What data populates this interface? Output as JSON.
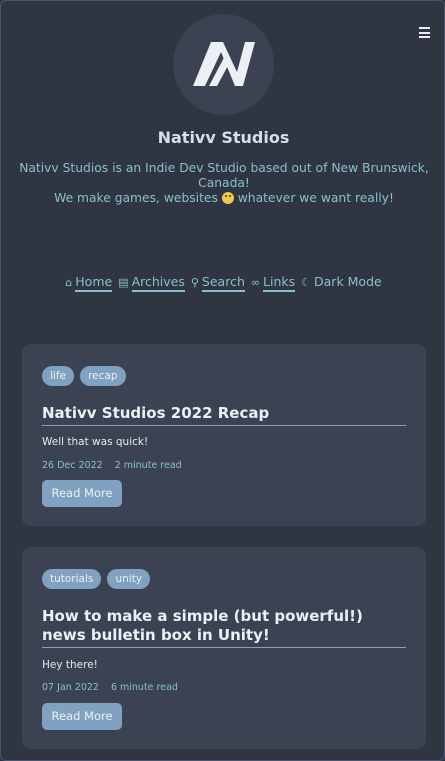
{
  "site": {
    "title": "Nativv Studios",
    "desc_line1": "Nativv Studios is an Indie Dev Studio based out of New Brunswick, Canada!",
    "desc_line2_a": "We make games, websites",
    "desc_line2_b": "whatever we want really!"
  },
  "nav": [
    {
      "label": "Home",
      "icon": "home-icon"
    },
    {
      "label": "Archives",
      "icon": "archive-icon"
    },
    {
      "label": "Search",
      "icon": "search-icon"
    },
    {
      "label": "Links",
      "icon": "link-icon"
    },
    {
      "label": "Dark Mode",
      "icon": "moon-icon"
    }
  ],
  "posts": [
    {
      "tags": [
        "life",
        "recap"
      ],
      "title": "Nativv Studios 2022 Recap",
      "excerpt": "Well that was quick!",
      "date": "26 Dec 2022",
      "read_time": "2 minute read",
      "button": "Read More"
    },
    {
      "tags": [
        "tutorials",
        "unity"
      ],
      "title": "How to make a simple (but powerful!) news bulletin box in Unity!",
      "excerpt": "Hey there!",
      "date": "07 Jan 2022",
      "read_time": "6 minute read",
      "button": "Read More"
    }
  ],
  "colors": {
    "background": "#2e3440",
    "card": "#3b4252",
    "accent": "#88c0d0",
    "tag": "#81a1c1"
  }
}
